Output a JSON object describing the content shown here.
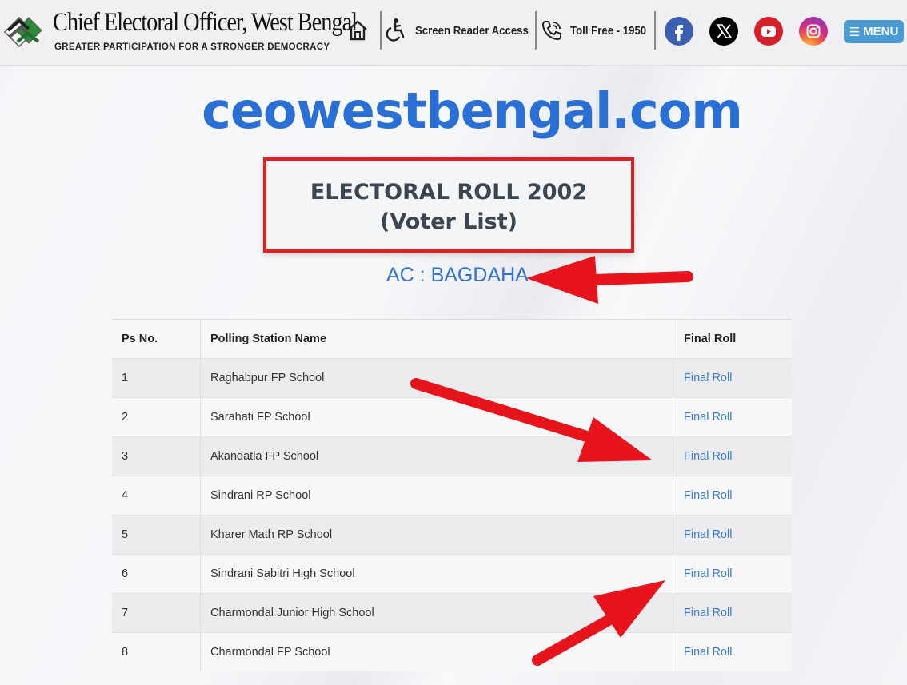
{
  "header": {
    "title": "Chief Electoral Officer, West Bengal",
    "tagline": "GREATER PARTICIPATION FOR A STRONGER DEMOCRACY",
    "screen_reader_label": "Screen Reader Access",
    "toll_free_label": "Toll Free - 1950",
    "menu_label": "MENU",
    "social": [
      "facebook-icon",
      "x-icon",
      "youtube-icon",
      "instagram-icon"
    ]
  },
  "hero": {
    "site_name": "ceowestbengal.com",
    "title_line1": "ELECTORAL ROLL 2002",
    "title_line2": "(Voter List)",
    "ac_label": "AC : BAGDAHA"
  },
  "table": {
    "headers": [
      "Ps No.",
      "Polling Station Name",
      "Final Roll"
    ],
    "rows": [
      {
        "no": "1",
        "name": "Raghabpur FP School",
        "link": "Final Roll"
      },
      {
        "no": "2",
        "name": "Sarahati FP School",
        "link": "Final Roll"
      },
      {
        "no": "3",
        "name": "Akandatla FP School",
        "link": "Final Roll"
      },
      {
        "no": "4",
        "name": "Sindrani RP School",
        "link": "Final Roll"
      },
      {
        "no": "5",
        "name": "Kharer Math RP School",
        "link": "Final Roll"
      },
      {
        "no": "6",
        "name": "Sindrani Sabitri High School",
        "link": "Final Roll"
      },
      {
        "no": "7",
        "name": "Charmondal Junior High School",
        "link": "Final Roll"
      },
      {
        "no": "8",
        "name": "Charmondal FP School",
        "link": "Final Roll"
      }
    ]
  },
  "colors": {
    "accent_blue": "#2a6fd6",
    "link_blue": "#3a7bd5",
    "highlight_red": "#e02020",
    "menu_blue": "#4a9ad4"
  }
}
